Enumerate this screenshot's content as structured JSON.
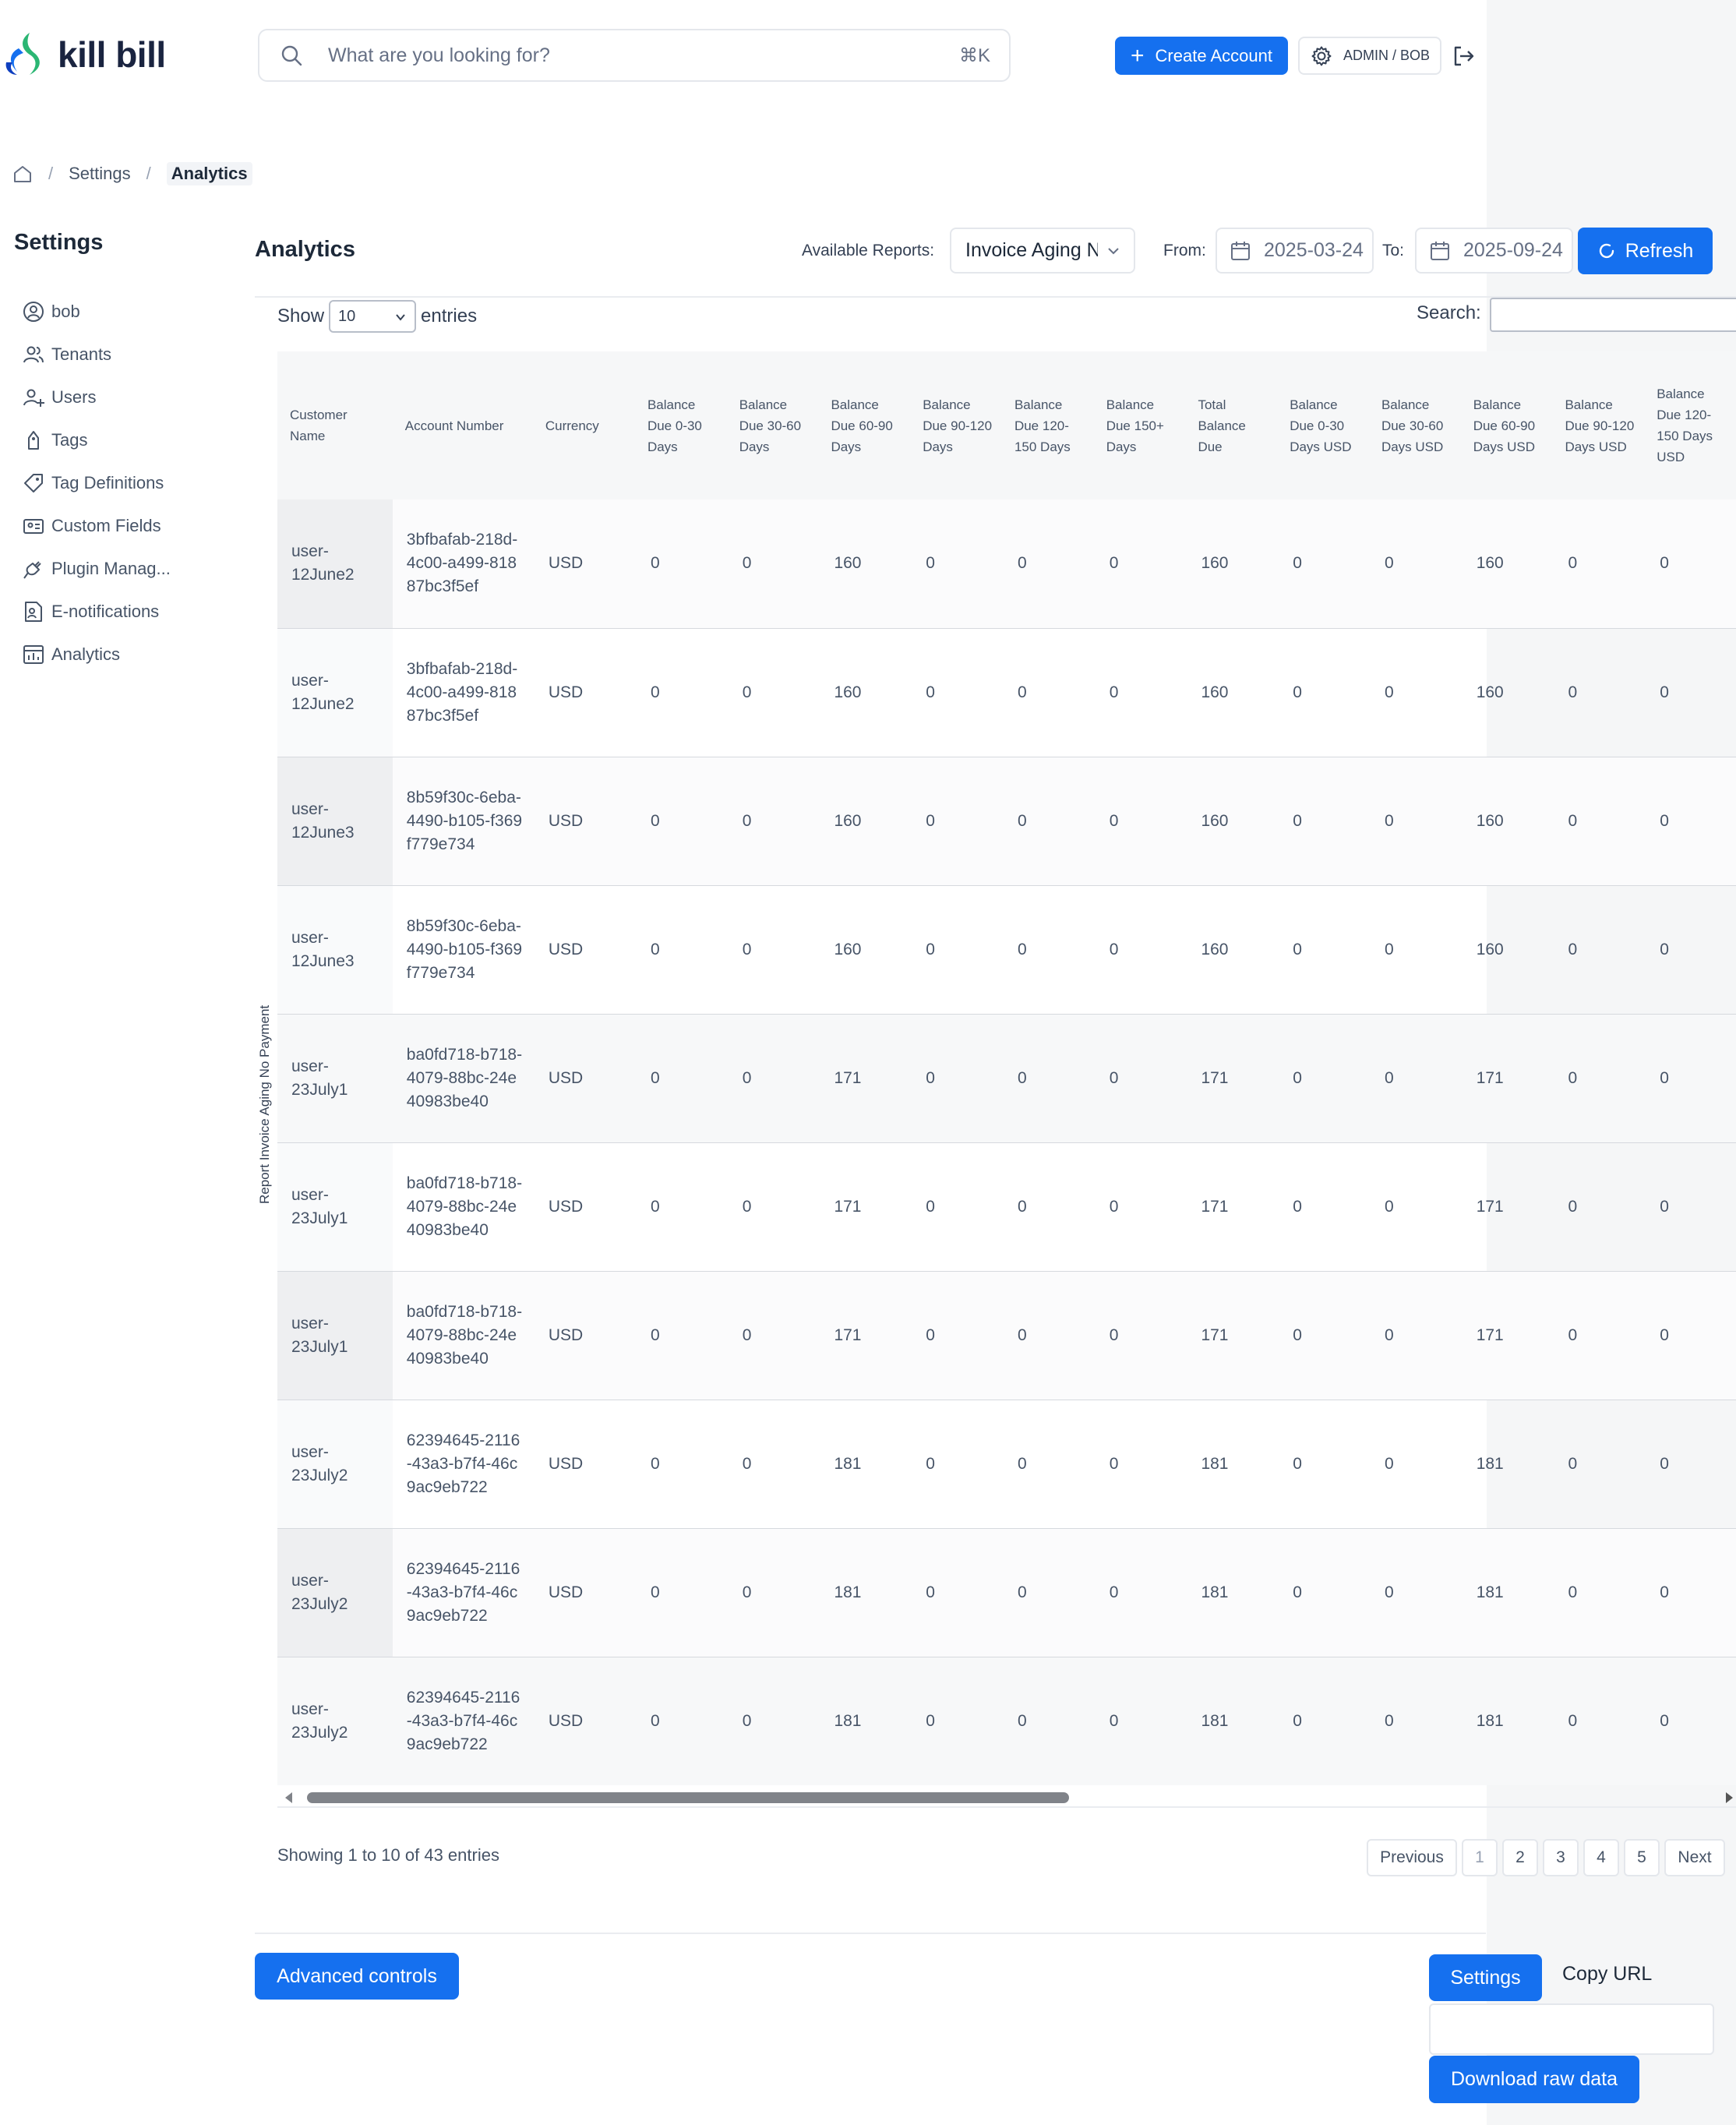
{
  "app": {
    "logo_text": "kill bill"
  },
  "header": {
    "search_placeholder": "What are you looking for?",
    "search_shortcut": "⌘K",
    "create_account_label": "Create Account",
    "user_label": "ADMIN / BOB"
  },
  "breadcrumb": {
    "settings": "Settings",
    "current": "Analytics"
  },
  "sidebar": {
    "title": "Settings",
    "items": [
      {
        "label": "bob",
        "icon": "user-circle-icon"
      },
      {
        "label": "Tenants",
        "icon": "users-icon"
      },
      {
        "label": "Users",
        "icon": "user-plus-icon"
      },
      {
        "label": "Tags",
        "icon": "tag-icon"
      },
      {
        "label": "Tag Definitions",
        "icon": "tag-outline-icon"
      },
      {
        "label": "Custom Fields",
        "icon": "id-card-icon"
      },
      {
        "label": "Plugin Manag...",
        "icon": "plug-icon"
      },
      {
        "label": "E-notifications",
        "icon": "document-user-icon"
      },
      {
        "label": "Analytics",
        "icon": "analytics-icon"
      }
    ]
  },
  "analytics": {
    "title": "Analytics",
    "available_reports_label": "Available Reports:",
    "report_selected": "Invoice Aging No Payment",
    "from_label": "From:",
    "from_value": "2025-03-24",
    "to_label": "To:",
    "to_value": "2025-09-24",
    "refresh_label": "Refresh",
    "report_vertical_label": "Report Invoice Aging No Payment"
  },
  "table": {
    "show_label": "Show",
    "entries_label": "entries",
    "page_size": "10",
    "search_label": "Search:",
    "columns": [
      "Customer Name",
      "Account Number",
      "Currency",
      "Balance Due 0-30 Days",
      "Balance Due 30-60 Days",
      "Balance Due 60-90 Days",
      "Balance Due 90-120 Days",
      "Balance Due 120-150 Days",
      "Balance Due 150+ Days",
      "Total Balance Due",
      "Balance Due 0-30 Days USD",
      "Balance Due 30-60 Days USD",
      "Balance Due 60-90 Days USD",
      "Balance Due 90-120 Days USD",
      "Balance Due 120-150 Days USD"
    ],
    "rows": [
      [
        "user-12June2",
        "3bfbafab-218d-4c00-a499-81887bc3f5ef",
        "USD",
        "0",
        "0",
        "160",
        "0",
        "0",
        "0",
        "160",
        "0",
        "0",
        "160",
        "0",
        "0"
      ],
      [
        "user-12June2",
        "3bfbafab-218d-4c00-a499-81887bc3f5ef",
        "USD",
        "0",
        "0",
        "160",
        "0",
        "0",
        "0",
        "160",
        "0",
        "0",
        "160",
        "0",
        "0"
      ],
      [
        "user-12June3",
        "8b59f30c-6eba-4490-b105-f369f779e734",
        "USD",
        "0",
        "0",
        "160",
        "0",
        "0",
        "0",
        "160",
        "0",
        "0",
        "160",
        "0",
        "0"
      ],
      [
        "user-12June3",
        "8b59f30c-6eba-4490-b105-f369f779e734",
        "USD",
        "0",
        "0",
        "160",
        "0",
        "0",
        "0",
        "160",
        "0",
        "0",
        "160",
        "0",
        "0"
      ],
      [
        "user-23July1",
        "ba0fd718-b718-4079-88bc-24e40983be40",
        "USD",
        "0",
        "0",
        "171",
        "0",
        "0",
        "0",
        "171",
        "0",
        "0",
        "171",
        "0",
        "0"
      ],
      [
        "user-23July1",
        "ba0fd718-b718-4079-88bc-24e40983be40",
        "USD",
        "0",
        "0",
        "171",
        "0",
        "0",
        "0",
        "171",
        "0",
        "0",
        "171",
        "0",
        "0"
      ],
      [
        "user-23July1",
        "ba0fd718-b718-4079-88bc-24e40983be40",
        "USD",
        "0",
        "0",
        "171",
        "0",
        "0",
        "0",
        "171",
        "0",
        "0",
        "171",
        "0",
        "0"
      ],
      [
        "user-23July2",
        "62394645-2116-43a3-b7f4-46c9ac9eb722",
        "USD",
        "0",
        "0",
        "181",
        "0",
        "0",
        "0",
        "181",
        "0",
        "0",
        "181",
        "0",
        "0"
      ],
      [
        "user-23July2",
        "62394645-2116-43a3-b7f4-46c9ac9eb722",
        "USD",
        "0",
        "0",
        "181",
        "0",
        "0",
        "0",
        "181",
        "0",
        "0",
        "181",
        "0",
        "0"
      ],
      [
        "user-23July2",
        "62394645-2116-43a3-b7f4-46c9ac9eb722",
        "USD",
        "0",
        "0",
        "181",
        "0",
        "0",
        "0",
        "181",
        "0",
        "0",
        "181",
        "0",
        "0"
      ]
    ],
    "info": "Showing 1 to 10 of 43 entries",
    "pagination": {
      "previous": "Previous",
      "pages": [
        "1",
        "2",
        "3",
        "4",
        "5"
      ],
      "next": "Next"
    }
  },
  "footer": {
    "advanced_controls": "Advanced controls",
    "settings": "Settings",
    "copy_url": "Copy URL",
    "download_raw": "Download raw data"
  },
  "colors": {
    "primary": "#1570ef",
    "text": "#344054",
    "border": "#e4e7ec"
  }
}
